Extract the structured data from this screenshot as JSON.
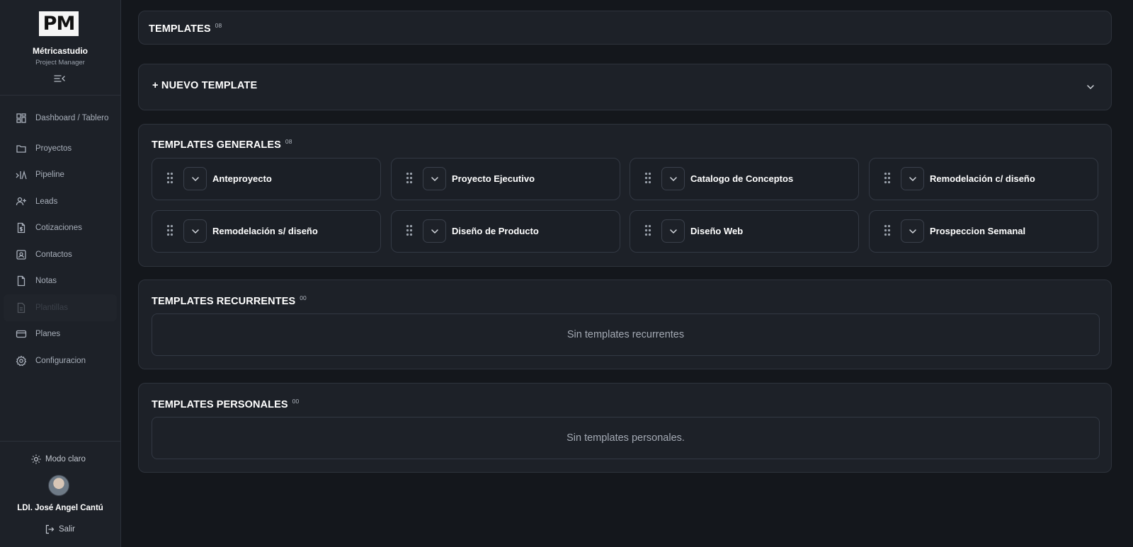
{
  "sidebar": {
    "logo_text": "PM",
    "brand_name": "Métricastudio",
    "brand_subtitle": "Project Manager",
    "items": [
      {
        "label": "Dashboard / Tablero",
        "icon": "dashboard-icon"
      },
      {
        "label": "Proyectos",
        "icon": "folder-icon"
      },
      {
        "label": "Pipeline",
        "icon": "pipeline-icon"
      },
      {
        "label": "Leads",
        "icon": "user-plus-icon"
      },
      {
        "label": "Cotizaciones",
        "icon": "invoice-icon"
      },
      {
        "label": "Contactos",
        "icon": "contact-card-icon"
      },
      {
        "label": "Notas",
        "icon": "file-icon"
      },
      {
        "label": "Plantillas",
        "icon": "template-file-icon",
        "active": true
      },
      {
        "label": "Planes",
        "icon": "credit-card-icon"
      },
      {
        "label": "Configuracion",
        "icon": "gear-icon"
      }
    ],
    "mode_toggle": "Modo claro",
    "user_name": "LDI. José Angel Cantú",
    "logout": "Salir"
  },
  "header": {
    "title": "TEMPLATES",
    "count": "08"
  },
  "new_template": {
    "label": "+ NUEVO TEMPLATE"
  },
  "general": {
    "title": "TEMPLATES GENERALES",
    "count": "08",
    "templates": [
      "Anteproyecto",
      "Proyecto Ejecutivo",
      "Catalogo de Conceptos",
      "Remodelación c/ diseño",
      "Remodelación s/ diseño",
      "Diseño de Producto",
      "Diseño Web",
      "Prospeccion Semanal"
    ]
  },
  "recurrentes": {
    "title": "TEMPLATES RECURRENTES",
    "count": "00",
    "empty_text": "Sin templates recurrentes"
  },
  "personales": {
    "title": "TEMPLATES PERSONALES",
    "count": "00",
    "empty_text": "Sin templates personales."
  }
}
